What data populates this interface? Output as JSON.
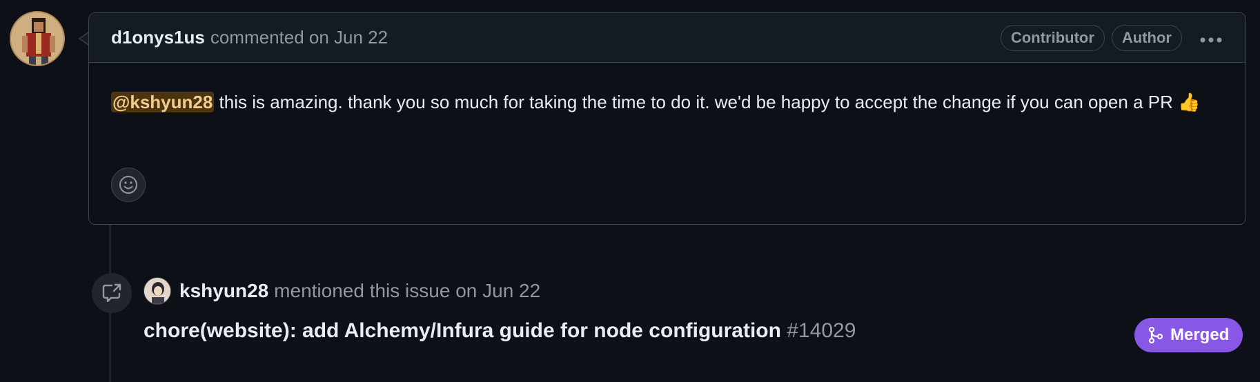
{
  "comment": {
    "author": "d1onys1us",
    "meta": "commented on Jun 22",
    "labels": [
      "Contributor",
      "Author"
    ],
    "more_icon": "kebab-horizontal-icon",
    "body": {
      "mention": "@kshyun28",
      "text": " this is amazing. thank you so much for taking the time to do it. we'd be happy to accept the change if you can open a PR",
      "emoji": "👍"
    },
    "reaction_icon": "smiley-icon"
  },
  "event": {
    "icon": "cross-reference-icon",
    "user": "kshyun28",
    "text": "mentioned this issue on Jun 22",
    "pr": {
      "title": "chore(website): add Alchemy/Infura guide for node configuration",
      "number": "#14029",
      "status": "Merged",
      "status_icon": "git-merge-icon",
      "status_color": "#8957e5"
    }
  }
}
